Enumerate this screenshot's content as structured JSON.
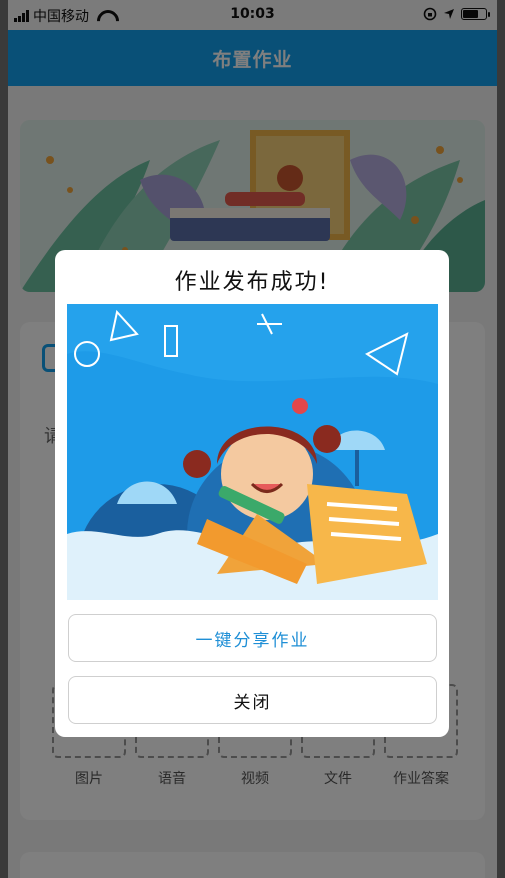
{
  "status_bar": {
    "carrier": "中国移动",
    "time": "10:03",
    "wifi_icon": "wifi-icon",
    "location_icon": "location-arrow-icon",
    "lock_icon": "rotation-lock-icon"
  },
  "navbar": {
    "title": "布置作业"
  },
  "card": {
    "keyword": "请",
    "attachments": [
      {
        "label": "图片"
      },
      {
        "label": "语音"
      },
      {
        "label": "视频"
      },
      {
        "label": "文件"
      },
      {
        "label": "作业答案"
      }
    ]
  },
  "modal": {
    "title": "作业发布成功!",
    "share_label": "一键分享作业",
    "close_label": "关闭"
  },
  "colors": {
    "accent": "#12a1ee",
    "share_text": "#1f8fd6",
    "overlay": "rgba(0,0,0,0.5)"
  }
}
